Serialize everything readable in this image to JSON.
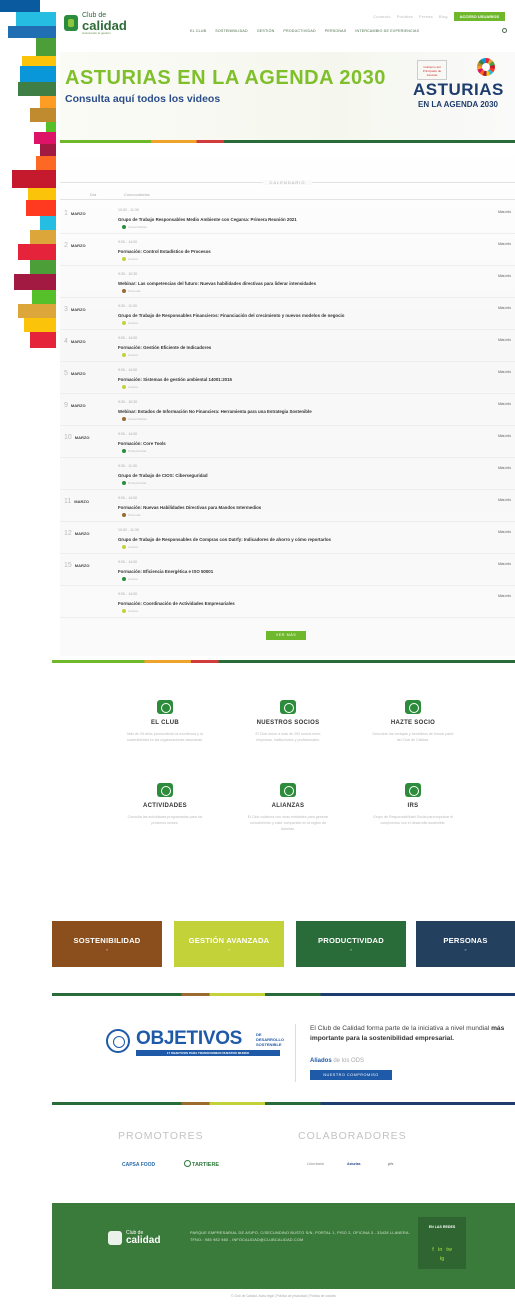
{
  "brand": {
    "line1": "Club de",
    "line2": "calidad",
    "tagline": "Avanzando la gestión"
  },
  "topbar": {
    "links": [
      "Contacto",
      "Portales",
      "Prensa",
      "Blog"
    ],
    "access_label": "ACCESO USUARIOS"
  },
  "nav": {
    "items": [
      "EL CLUB",
      "SOSTENIBILIDAD",
      "GESTIÓN",
      "PRODUCTIVIDAD",
      "PERSONAS",
      "INTERCAMBIO DE EXPERIENCIAS"
    ]
  },
  "hero": {
    "title": "ASTURIAS EN LA AGENDA 2030",
    "subtitle": "Consulta aquí todos los videos",
    "badge_gov": "Gobierno del Principado de Asturias",
    "badge_title": "ASTURIAS",
    "badge_sub": "EN LA AGENDA 2030"
  },
  "calendar": {
    "heading": "CALENDARIO",
    "col_day": "Día",
    "col_event": "Convocatorias",
    "more_label": "Más info",
    "events": [
      {
        "day": "1",
        "month": "MARZO",
        "time": "10:00 - 11:30",
        "title": "Grupo de Trabajo Responsables Medio Ambiente con Cegarsa: Primera Reunión 2021",
        "category": "Sostenibilidad",
        "color": "#2d8c3c"
      },
      {
        "day": "2",
        "month": "MARZO",
        "time": "9:00 - 14:00",
        "title": "Formación: Control Estadístico de Procesos",
        "category": "Gestión",
        "color": "#c4d23a"
      },
      {
        "day": "",
        "month": "",
        "time": "9:30 - 10:30",
        "title": "Webinar: Las competencias del futuro: Nuevas habilidades directivas para liderar intensidades",
        "category": "Personas",
        "color": "#9b6a2e"
      },
      {
        "day": "3",
        "month": "MARZO",
        "time": "9:30 - 11:00",
        "title": "Grupo de Trabajo de Responsables Financieros: Financiación del crecimiento y nuevos modelos de negocio",
        "category": "Gestión",
        "color": "#c4d23a"
      },
      {
        "day": "4",
        "month": "MARZO",
        "time": "9:00 - 14:00",
        "title": "Formación: Gestión Eficiente de Indicadores",
        "category": "Gestión",
        "color": "#c4d23a"
      },
      {
        "day": "5",
        "month": "MARZO",
        "time": "9:00 - 14:00",
        "title": "Formación: Sistemas de gestión ambiental 14001:2015",
        "category": "Gestión",
        "color": "#c4d23a"
      },
      {
        "day": "9",
        "month": "MARZO",
        "time": "9:30 - 10:30",
        "title": "Webinar: Estados de Información No Financiera: Herramienta para una Estrategia Sostenible",
        "category": "Sostenibilidad",
        "color": "#9b6a2e"
      },
      {
        "day": "10",
        "month": "MARZO",
        "time": "9:00 - 14:00",
        "title": "Formación: Core Tools",
        "category": "Productividad",
        "color": "#2d8c3c"
      },
      {
        "day": "",
        "month": "",
        "time": "9:30 - 11:00",
        "title": "Grupo de Trabajo de CIOS: Ciberseguridad",
        "category": "Productividad",
        "color": "#2d8c3c"
      },
      {
        "day": "11",
        "month": "MARZO",
        "time": "9:00 - 14:00",
        "title": "Formación: Nuevas Habilidades Directivas para Mandos Intermedios",
        "category": "Personas",
        "color": "#9b6a2e"
      },
      {
        "day": "12",
        "month": "MARZO",
        "time": "10:00 - 11:30",
        "title": "Grupo de Trabajo de Responsables de Compras con Datrfy: Indicadores de ahorro y cómo reportarlos",
        "category": "Gestión",
        "color": "#c4d23a"
      },
      {
        "day": "15",
        "month": "MARZO",
        "time": "9:00 - 14:00",
        "title": "Formación: Eficiencia Energética e ISO 50001",
        "category": "Gestión",
        "color": "#2d8c3c"
      },
      {
        "day": "",
        "month": "",
        "time": "9:00 - 14:00",
        "title": "Formación: Coordinación de Actividades Empresariales",
        "category": "Gestión",
        "color": "#c4d23a"
      }
    ],
    "load_more": "VER MÁS"
  },
  "features": [
    {
      "title": "EL CLUB",
      "desc": "Más de 25 años promoviendo la excelencia y la sostenibilidad en las organizaciones asturianas."
    },
    {
      "title": "NUESTROS SOCIOS",
      "desc": "El Club reúne a más de 200 socios entre empresas, instituciones y profesionales."
    },
    {
      "title": "HAZTE SOCIO",
      "desc": "Descubre las ventajas y beneficios de formar parte del Club de Calidad."
    },
    {
      "title": "ACTIVIDADES",
      "desc": "Consulta las actividades programadas para los próximos meses."
    },
    {
      "title": "ALIANZAS",
      "desc": "El Club colabora con otras entidades para generar conocimiento y valor compartido en la región de Asturias."
    },
    {
      "title": "IRS",
      "desc": "Grupo de Responsabilidad Social para impulsar el compromiso con el desarrollo sostenible."
    }
  ],
  "tiles": [
    {
      "label": "SOSTENIBILIDAD",
      "color": "#8a4f1c"
    },
    {
      "label": "GESTIÓN AVANZADA",
      "color": "#c4d23a"
    },
    {
      "label": "PRODUCTIVIDAD",
      "color": "#2a6b3a"
    },
    {
      "label": "PERSONAS",
      "color": "#23405e"
    }
  ],
  "ods": {
    "logo_word": "OBJETIVOS",
    "logo_small_1": "DE DESARROLLO",
    "logo_small_2": "SOSTENIBLE",
    "logo_bar": "17 OBJETIVOS PARA TRANSFORMAR NUESTRO MUNDO",
    "text_1": "El Club de Calidad forma parte de la iniciativa a nivel mundial ",
    "text_bold": "más importante para la sostenibilidad empresarial.",
    "aliados_bold": "Aliados",
    "aliados_rest": " de los ODS",
    "button": "NUESTRO COMPROMISO"
  },
  "partners": {
    "promotores": "PROMOTORES",
    "colaboradores": "COLABORADORES",
    "promotor_logos": [
      "CAPSA FOOD",
      "TARTIERE"
    ],
    "colaborador_logos": [
      "Liberbank",
      "Asturias",
      "pfs"
    ]
  },
  "footer": {
    "logo_1": "Club de",
    "logo_2": "calidad",
    "address": "PARQUE EMPRESARIAL DE ASIPO, C/SECUNDINO BUSTO S/N, PORTAL 1, PISO 2, OFICINA 3 - 33428 LLANERA. TFNO.: 985 982 980 - INFOCALIDAD@CLUBCALIDAD.COM",
    "social_title": "EN LAS REDES",
    "social_icons": [
      "f",
      "in",
      "tw"
    ],
    "social_ig": "ig"
  },
  "legal": "© Club de Calidad. Aviso legal | Política de privacidad | Política de cookies"
}
